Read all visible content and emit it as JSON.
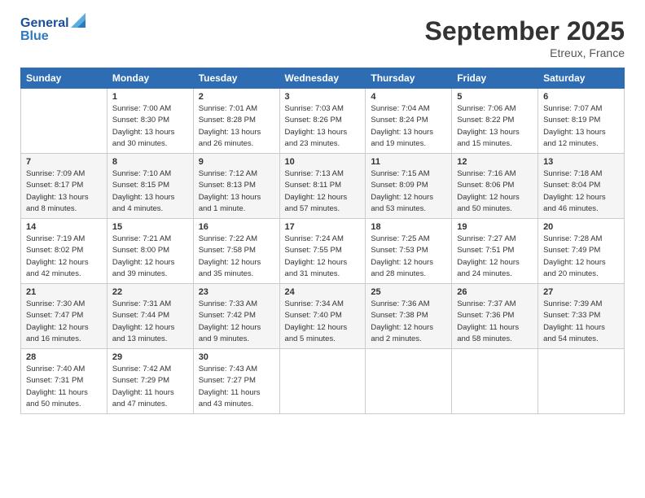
{
  "logo": {
    "line1": "General",
    "line2": "Blue"
  },
  "title": "September 2025",
  "location": "Etreux, France",
  "days_header": [
    "Sunday",
    "Monday",
    "Tuesday",
    "Wednesday",
    "Thursday",
    "Friday",
    "Saturday"
  ],
  "weeks": [
    [
      {
        "day": "",
        "sunrise": "",
        "sunset": "",
        "daylight": ""
      },
      {
        "day": "1",
        "sunrise": "Sunrise: 7:00 AM",
        "sunset": "Sunset: 8:30 PM",
        "daylight": "Daylight: 13 hours and 30 minutes."
      },
      {
        "day": "2",
        "sunrise": "Sunrise: 7:01 AM",
        "sunset": "Sunset: 8:28 PM",
        "daylight": "Daylight: 13 hours and 26 minutes."
      },
      {
        "day": "3",
        "sunrise": "Sunrise: 7:03 AM",
        "sunset": "Sunset: 8:26 PM",
        "daylight": "Daylight: 13 hours and 23 minutes."
      },
      {
        "day": "4",
        "sunrise": "Sunrise: 7:04 AM",
        "sunset": "Sunset: 8:24 PM",
        "daylight": "Daylight: 13 hours and 19 minutes."
      },
      {
        "day": "5",
        "sunrise": "Sunrise: 7:06 AM",
        "sunset": "Sunset: 8:22 PM",
        "daylight": "Daylight: 13 hours and 15 minutes."
      },
      {
        "day": "6",
        "sunrise": "Sunrise: 7:07 AM",
        "sunset": "Sunset: 8:19 PM",
        "daylight": "Daylight: 13 hours and 12 minutes."
      }
    ],
    [
      {
        "day": "7",
        "sunrise": "Sunrise: 7:09 AM",
        "sunset": "Sunset: 8:17 PM",
        "daylight": "Daylight: 13 hours and 8 minutes."
      },
      {
        "day": "8",
        "sunrise": "Sunrise: 7:10 AM",
        "sunset": "Sunset: 8:15 PM",
        "daylight": "Daylight: 13 hours and 4 minutes."
      },
      {
        "day": "9",
        "sunrise": "Sunrise: 7:12 AM",
        "sunset": "Sunset: 8:13 PM",
        "daylight": "Daylight: 13 hours and 1 minute."
      },
      {
        "day": "10",
        "sunrise": "Sunrise: 7:13 AM",
        "sunset": "Sunset: 8:11 PM",
        "daylight": "Daylight: 12 hours and 57 minutes."
      },
      {
        "day": "11",
        "sunrise": "Sunrise: 7:15 AM",
        "sunset": "Sunset: 8:09 PM",
        "daylight": "Daylight: 12 hours and 53 minutes."
      },
      {
        "day": "12",
        "sunrise": "Sunrise: 7:16 AM",
        "sunset": "Sunset: 8:06 PM",
        "daylight": "Daylight: 12 hours and 50 minutes."
      },
      {
        "day": "13",
        "sunrise": "Sunrise: 7:18 AM",
        "sunset": "Sunset: 8:04 PM",
        "daylight": "Daylight: 12 hours and 46 minutes."
      }
    ],
    [
      {
        "day": "14",
        "sunrise": "Sunrise: 7:19 AM",
        "sunset": "Sunset: 8:02 PM",
        "daylight": "Daylight: 12 hours and 42 minutes."
      },
      {
        "day": "15",
        "sunrise": "Sunrise: 7:21 AM",
        "sunset": "Sunset: 8:00 PM",
        "daylight": "Daylight: 12 hours and 39 minutes."
      },
      {
        "day": "16",
        "sunrise": "Sunrise: 7:22 AM",
        "sunset": "Sunset: 7:58 PM",
        "daylight": "Daylight: 12 hours and 35 minutes."
      },
      {
        "day": "17",
        "sunrise": "Sunrise: 7:24 AM",
        "sunset": "Sunset: 7:55 PM",
        "daylight": "Daylight: 12 hours and 31 minutes."
      },
      {
        "day": "18",
        "sunrise": "Sunrise: 7:25 AM",
        "sunset": "Sunset: 7:53 PM",
        "daylight": "Daylight: 12 hours and 28 minutes."
      },
      {
        "day": "19",
        "sunrise": "Sunrise: 7:27 AM",
        "sunset": "Sunset: 7:51 PM",
        "daylight": "Daylight: 12 hours and 24 minutes."
      },
      {
        "day": "20",
        "sunrise": "Sunrise: 7:28 AM",
        "sunset": "Sunset: 7:49 PM",
        "daylight": "Daylight: 12 hours and 20 minutes."
      }
    ],
    [
      {
        "day": "21",
        "sunrise": "Sunrise: 7:30 AM",
        "sunset": "Sunset: 7:47 PM",
        "daylight": "Daylight: 12 hours and 16 minutes."
      },
      {
        "day": "22",
        "sunrise": "Sunrise: 7:31 AM",
        "sunset": "Sunset: 7:44 PM",
        "daylight": "Daylight: 12 hours and 13 minutes."
      },
      {
        "day": "23",
        "sunrise": "Sunrise: 7:33 AM",
        "sunset": "Sunset: 7:42 PM",
        "daylight": "Daylight: 12 hours and 9 minutes."
      },
      {
        "day": "24",
        "sunrise": "Sunrise: 7:34 AM",
        "sunset": "Sunset: 7:40 PM",
        "daylight": "Daylight: 12 hours and 5 minutes."
      },
      {
        "day": "25",
        "sunrise": "Sunrise: 7:36 AM",
        "sunset": "Sunset: 7:38 PM",
        "daylight": "Daylight: 12 hours and 2 minutes."
      },
      {
        "day": "26",
        "sunrise": "Sunrise: 7:37 AM",
        "sunset": "Sunset: 7:36 PM",
        "daylight": "Daylight: 11 hours and 58 minutes."
      },
      {
        "day": "27",
        "sunrise": "Sunrise: 7:39 AM",
        "sunset": "Sunset: 7:33 PM",
        "daylight": "Daylight: 11 hours and 54 minutes."
      }
    ],
    [
      {
        "day": "28",
        "sunrise": "Sunrise: 7:40 AM",
        "sunset": "Sunset: 7:31 PM",
        "daylight": "Daylight: 11 hours and 50 minutes."
      },
      {
        "day": "29",
        "sunrise": "Sunrise: 7:42 AM",
        "sunset": "Sunset: 7:29 PM",
        "daylight": "Daylight: 11 hours and 47 minutes."
      },
      {
        "day": "30",
        "sunrise": "Sunrise: 7:43 AM",
        "sunset": "Sunset: 7:27 PM",
        "daylight": "Daylight: 11 hours and 43 minutes."
      },
      {
        "day": "",
        "sunrise": "",
        "sunset": "",
        "daylight": ""
      },
      {
        "day": "",
        "sunrise": "",
        "sunset": "",
        "daylight": ""
      },
      {
        "day": "",
        "sunrise": "",
        "sunset": "",
        "daylight": ""
      },
      {
        "day": "",
        "sunrise": "",
        "sunset": "",
        "daylight": ""
      }
    ]
  ]
}
